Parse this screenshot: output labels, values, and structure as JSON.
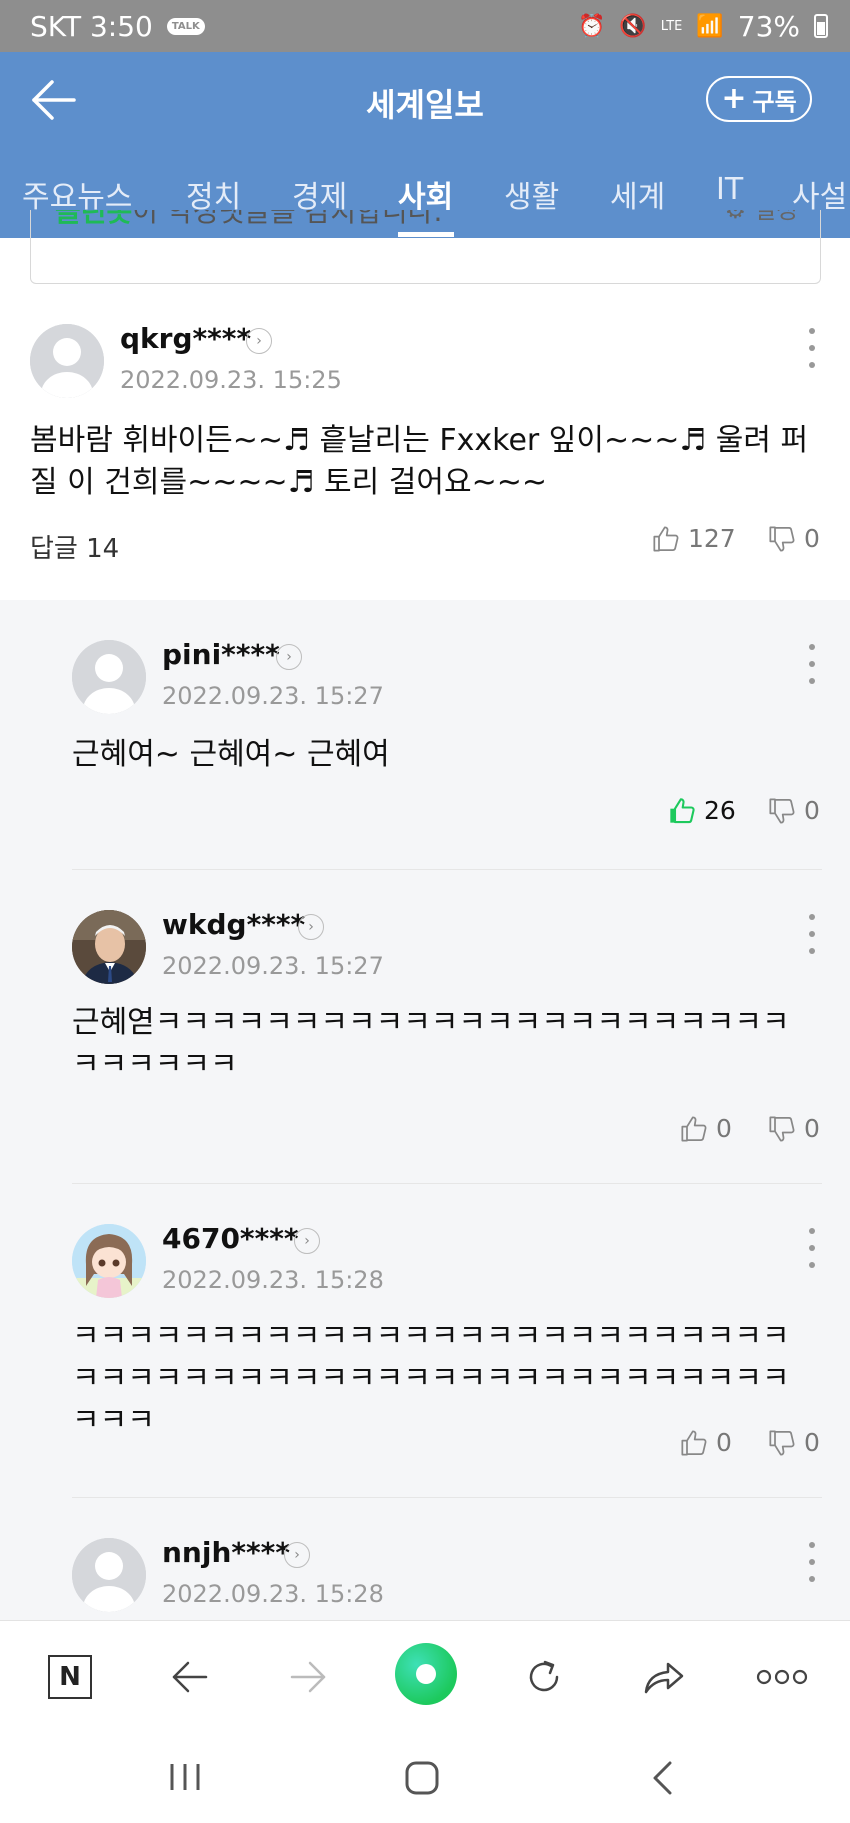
{
  "status_bar": {
    "carrier_time": "SKT 3:50",
    "talk": "TALK",
    "lte": "LTE",
    "battery": "73%"
  },
  "header": {
    "title": "세계일보",
    "subscribe_label": "구독"
  },
  "tabs": [
    "주요뉴스",
    "정치",
    "경제",
    "사회",
    "생활",
    "세계",
    "IT",
    "사설"
  ],
  "active_tab": "사회",
  "notice": {
    "brand": "클린봇",
    "text": "이 악성댓글을 감지합니다.",
    "setting": "설정"
  },
  "main_comment": {
    "username": "qkrg****",
    "timestamp": "2022.09.23. 15:25",
    "text": "봄바람 휘바이든~~♬ 흩날리는 Fxxker 잎이~~~♬ 울려 퍼질 이 건희를~~~~♬ 토리 걸어요~~~",
    "replies_label": "답글 14",
    "likes": "127",
    "dislikes": "0"
  },
  "replies": [
    {
      "username": "pini****",
      "timestamp": "2022.09.23. 15:27",
      "text": "근혜여~ 근혜여~ 근혜여",
      "likes": "26",
      "dislikes": "0",
      "liked": true,
      "avatar": "default"
    },
    {
      "username": "wkdg****",
      "timestamp": "2022.09.23. 15:27",
      "text": "근혜엳ㅋㅋㅋㅋㅋㅋㅋㅋㅋㅋㅋㅋㅋㅋㅋㅋㅋㅋㅋㅋㅋㅋㅋㅋㅋㅋㅋㅋㅋ",
      "likes": "0",
      "dislikes": "0",
      "liked": false,
      "avatar": "photo-man"
    },
    {
      "username": "4670****",
      "timestamp": "2022.09.23. 15:28",
      "text": "ㅋㅋㅋㅋㅋㅋㅋㅋㅋㅋㅋㅋㅋㅋㅋㅋㅋㅋㅋㅋㅋㅋㅋㅋㅋㅋㅋㅋㅋㅋㅋㅋㅋㅋㅋㅋㅋㅋㅋㅋㅋㅋㅋㅋㅋㅋㅋㅋㅋㅋㅋㅋㅋㅋㅋ",
      "likes": "0",
      "dislikes": "0",
      "liked": false,
      "avatar": "anime-girl"
    },
    {
      "username": "nnjh****",
      "timestamp": "2022.09.23. 15:28",
      "avatar": "default"
    }
  ],
  "bottom_bar": {
    "home_label": "N"
  },
  "colors": {
    "header": "#5d8fcc",
    "accent_green": "#1dc95d",
    "reply_bg": "#f5f6f8"
  }
}
